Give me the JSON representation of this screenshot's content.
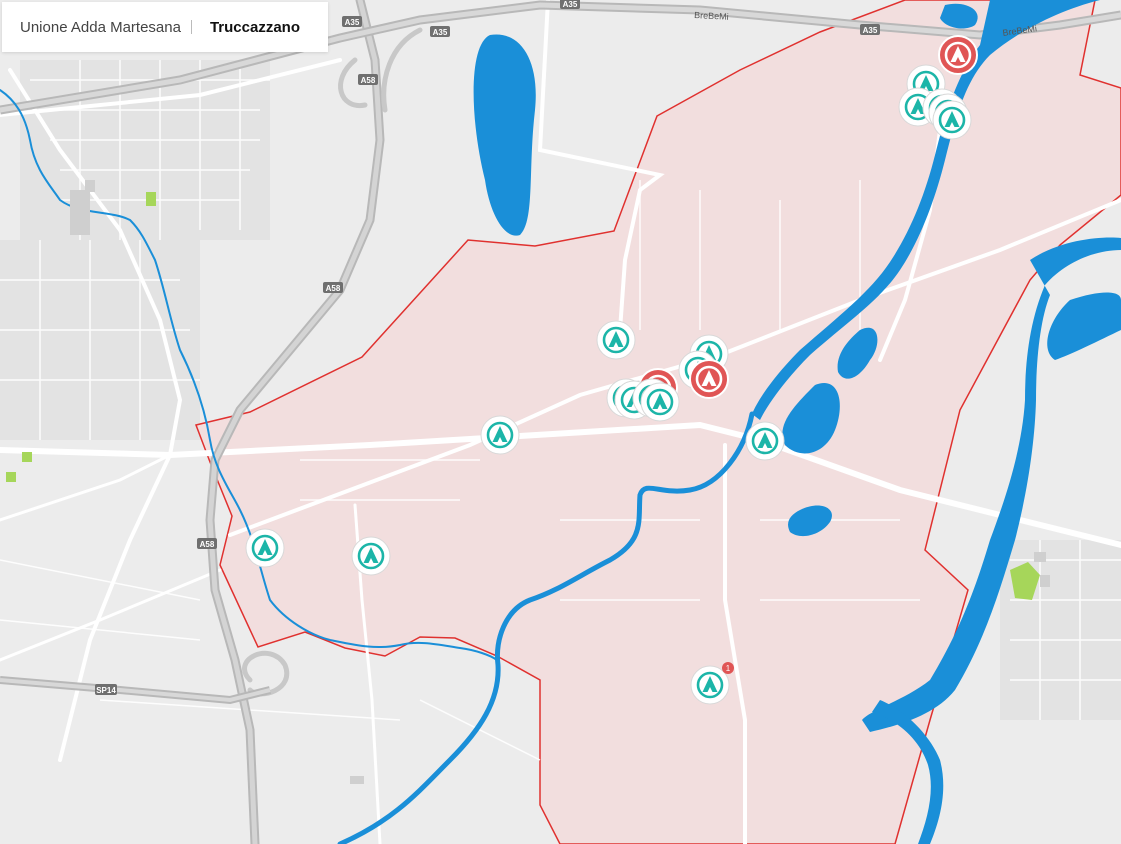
{
  "breadcrumb": {
    "parent": "Unione Adda Martesana",
    "current": "Truccazzano"
  },
  "road_labels": {
    "a35_left": "A35",
    "a35_top": "A35",
    "a35_right": "A35",
    "a58_top": "A58",
    "a58_mid": "A58",
    "a58_low": "A58",
    "brebemi_top": "BreBeMi",
    "brebemi_right": "BreBeMi",
    "sp14": "SP14"
  },
  "markers": {
    "cluster_badge": "1"
  },
  "colors": {
    "map_bg": "#ececec",
    "area_fill": "#f2dede",
    "boundary": "#e0312f",
    "water": "#1a8fd8",
    "road": "#ffffff",
    "marker_teal": "#1cb5a8",
    "marker_red": "#e05555",
    "park": "#a6d65a"
  },
  "icons": [
    "poi-teal-icon",
    "poi-red-icon"
  ]
}
